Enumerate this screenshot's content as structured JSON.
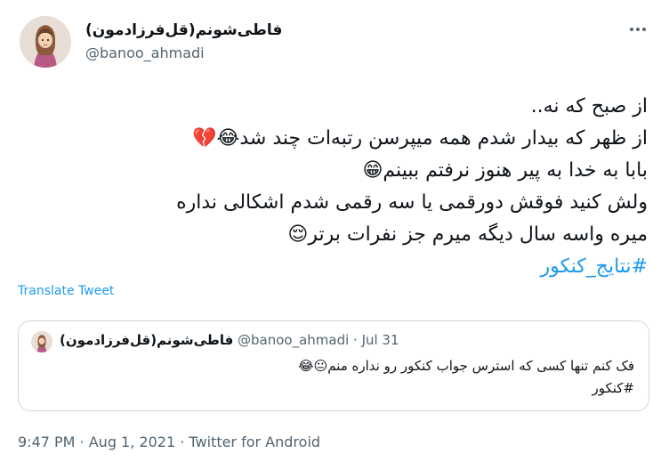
{
  "author": {
    "display_name": "فاطی‌شونم(قل‌فرزادمون)",
    "handle": "@banoo_ahmadi"
  },
  "more_icon": "more-horizontal-icon",
  "tweet": {
    "lines": [
      "از صبح که نه..",
      "از ظهر که بیدار شدم همه میپرسن رتبه‌ات چند شد😂💔",
      "بابا به خدا به پیر هنوز نرفتم ببینم😁",
      "ولش کنید فوقش دورقمی یا سه رقمی شدم اشکالی نداره",
      "میره واسه سال دیگه میرم جز نفرات برتر😌"
    ],
    "hashtag": "#نتایج_کنکور"
  },
  "translate_label": "Translate Tweet",
  "quoted_tweet": {
    "display_name": "فاطی‌شونم(قل‌فرزادمون)",
    "meta": "@banoo_ahmadi · Jul 31",
    "lines": [
      "فک کنم تنها کسی که استرس جواب کنکور رو نداره منم😐😂"
    ],
    "hashtag": "#کنکور"
  },
  "footer": "9:47 PM · Aug 1, 2021 · Twitter for Android",
  "colors": {
    "link": "#1d9bf0",
    "secondary_text": "#536471",
    "border": "#cfd9de"
  }
}
